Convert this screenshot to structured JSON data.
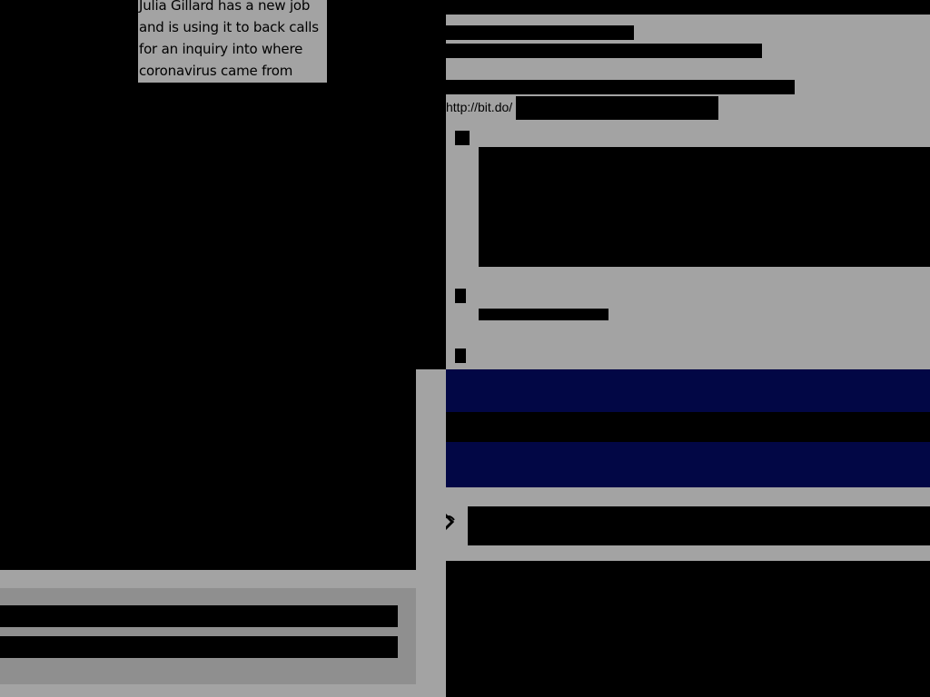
{
  "headline": {
    "text": "Julia Gillard has a new job and is using it to back calls for an inquiry into where coronavirus came from"
  },
  "article_panel": {
    "url_prefix": "http://bit.do/"
  },
  "icons": {
    "share": "share-link-icon"
  },
  "colors": {
    "panel_gray": "#a3a3a3",
    "banner_navy": "#020745",
    "redaction": "#000000"
  }
}
